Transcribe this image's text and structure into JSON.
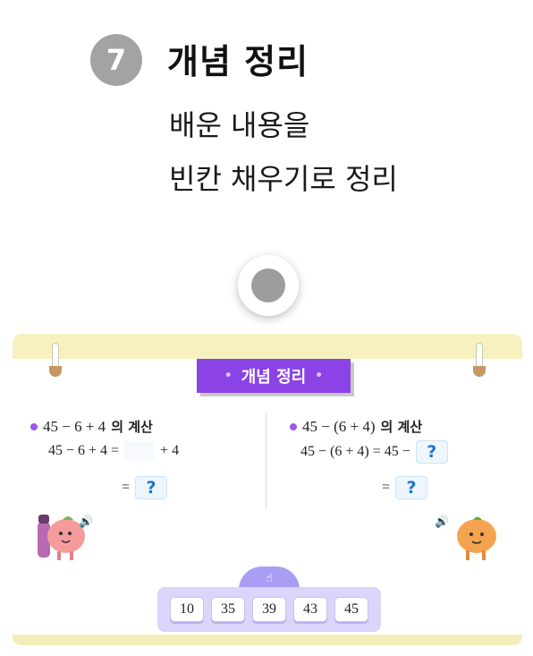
{
  "header": {
    "step_number": "7",
    "title": "개념 정리",
    "description_line1": "배운 내용을",
    "description_line2": "빈칸 채우기로 정리"
  },
  "board": {
    "banner_label": "개념 정리",
    "banner_dot": "•",
    "left": {
      "heading_expr": "45 − 6 + 4",
      "heading_suffix": "의 계산",
      "line1_lhs": "45 − 6 + 4 =",
      "line1_rhs": "+ 4",
      "line2_eq": "=",
      "placeholder": "?"
    },
    "right": {
      "heading_expr": "45 − (6 + 4)",
      "heading_suffix": "의 계산",
      "line1_lhs": "45 − (6 + 4) = 45 −",
      "line2_eq": "=",
      "placeholder": "?"
    },
    "answer_choices": [
      "10",
      "35",
      "39",
      "43",
      "45"
    ]
  },
  "icons": {
    "speaker_glyph": "🔊",
    "tray_handle_glyph": "☝"
  },
  "colors": {
    "banner": "#8b43e6",
    "tray": "#d9d5fb",
    "question_mark": "#1d75c9",
    "board_edge": "#f6f1bf",
    "step_badge": "#a3a3a3"
  }
}
